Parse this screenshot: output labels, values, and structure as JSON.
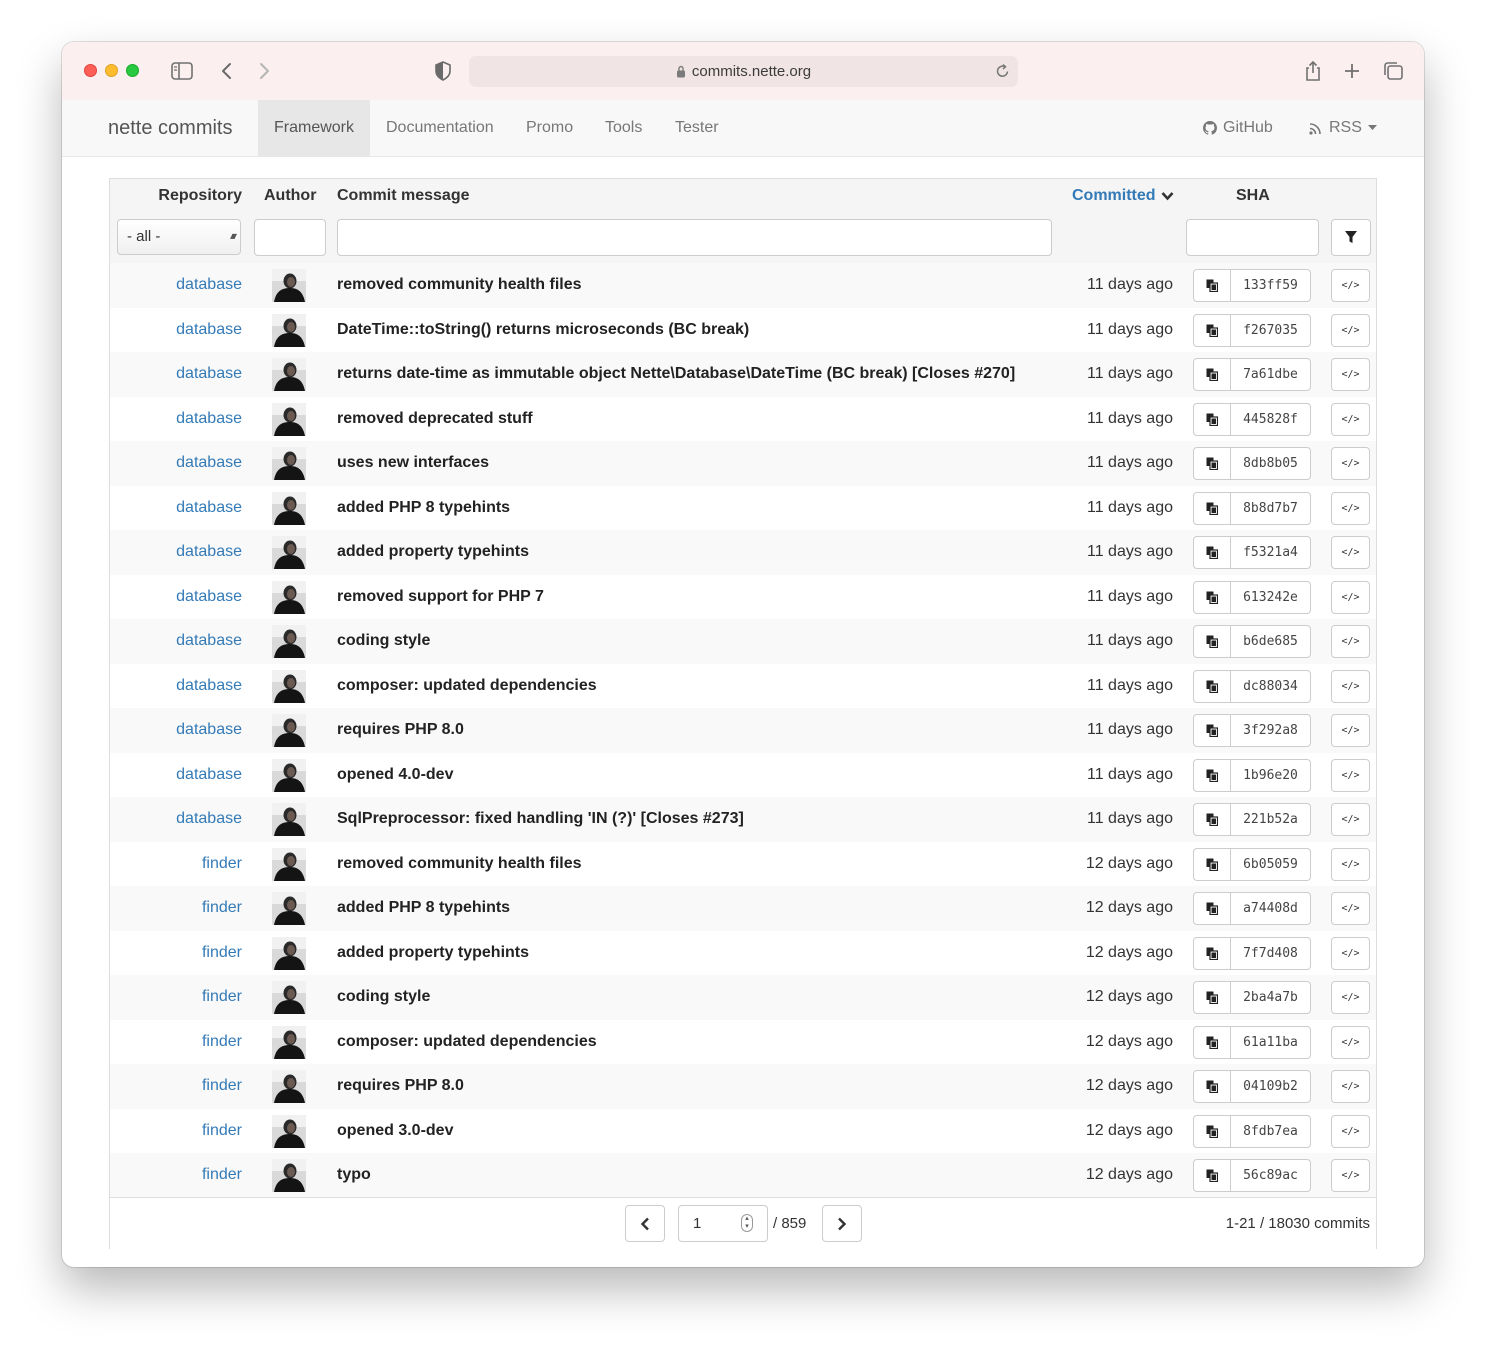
{
  "browser": {
    "url": "commits.nette.org"
  },
  "navbar": {
    "brand": "nette commits",
    "items": [
      {
        "label": "Framework",
        "active": true
      },
      {
        "label": "Documentation",
        "active": false
      },
      {
        "label": "Promo",
        "active": false
      },
      {
        "label": "Tools",
        "active": false
      },
      {
        "label": "Tester",
        "active": false
      }
    ],
    "github_label": "GitHub",
    "rss_label": "RSS"
  },
  "table": {
    "headers": {
      "repository": "Repository",
      "author": "Author",
      "message": "Commit message",
      "committed": "Committed",
      "sha": "SHA"
    },
    "repo_filter_value": "- all -",
    "rows": [
      {
        "repo": "database",
        "message": "removed community health files",
        "date": "11 days ago",
        "sha": "133ff59"
      },
      {
        "repo": "database",
        "message": "DateTime::toString() returns microseconds (BC break)",
        "date": "11 days ago",
        "sha": "f267035"
      },
      {
        "repo": "database",
        "message": "returns date-time as immutable object Nette\\Database\\DateTime (BC break) [Closes #270]",
        "date": "11 days ago",
        "sha": "7a61dbe"
      },
      {
        "repo": "database",
        "message": "removed deprecated stuff",
        "date": "11 days ago",
        "sha": "445828f"
      },
      {
        "repo": "database",
        "message": "uses new interfaces",
        "date": "11 days ago",
        "sha": "8db8b05"
      },
      {
        "repo": "database",
        "message": "added PHP 8 typehints",
        "date": "11 days ago",
        "sha": "8b8d7b7"
      },
      {
        "repo": "database",
        "message": "added property typehints",
        "date": "11 days ago",
        "sha": "f5321a4"
      },
      {
        "repo": "database",
        "message": "removed support for PHP 7",
        "date": "11 days ago",
        "sha": "613242e"
      },
      {
        "repo": "database",
        "message": "coding style",
        "date": "11 days ago",
        "sha": "b6de685"
      },
      {
        "repo": "database",
        "message": "composer: updated dependencies",
        "date": "11 days ago",
        "sha": "dc88034"
      },
      {
        "repo": "database",
        "message": "requires PHP 8.0",
        "date": "11 days ago",
        "sha": "3f292a8"
      },
      {
        "repo": "database",
        "message": "opened 4.0-dev",
        "date": "11 days ago",
        "sha": "1b96e20"
      },
      {
        "repo": "database",
        "message": "SqlPreprocessor: fixed handling 'IN (?)' [Closes #273]",
        "date": "11 days ago",
        "sha": "221b52a"
      },
      {
        "repo": "finder",
        "message": "removed community health files",
        "date": "12 days ago",
        "sha": "6b05059"
      },
      {
        "repo": "finder",
        "message": "added PHP 8 typehints",
        "date": "12 days ago",
        "sha": "a74408d"
      },
      {
        "repo": "finder",
        "message": "added property typehints",
        "date": "12 days ago",
        "sha": "7f7d408"
      },
      {
        "repo": "finder",
        "message": "coding style",
        "date": "12 days ago",
        "sha": "2ba4a7b"
      },
      {
        "repo": "finder",
        "message": "composer: updated dependencies",
        "date": "12 days ago",
        "sha": "61a11ba"
      },
      {
        "repo": "finder",
        "message": "requires PHP 8.0",
        "date": "12 days ago",
        "sha": "04109b2"
      },
      {
        "repo": "finder",
        "message": "opened 3.0-dev",
        "date": "12 days ago",
        "sha": "8fdb7ea"
      },
      {
        "repo": "finder",
        "message": "typo",
        "date": "12 days ago",
        "sha": "56c89ac"
      }
    ],
    "code_button_label": "</>"
  },
  "pagination": {
    "current_page": "1",
    "total_pages": "/ 859",
    "summary": "1-21 / 18030 commits"
  }
}
